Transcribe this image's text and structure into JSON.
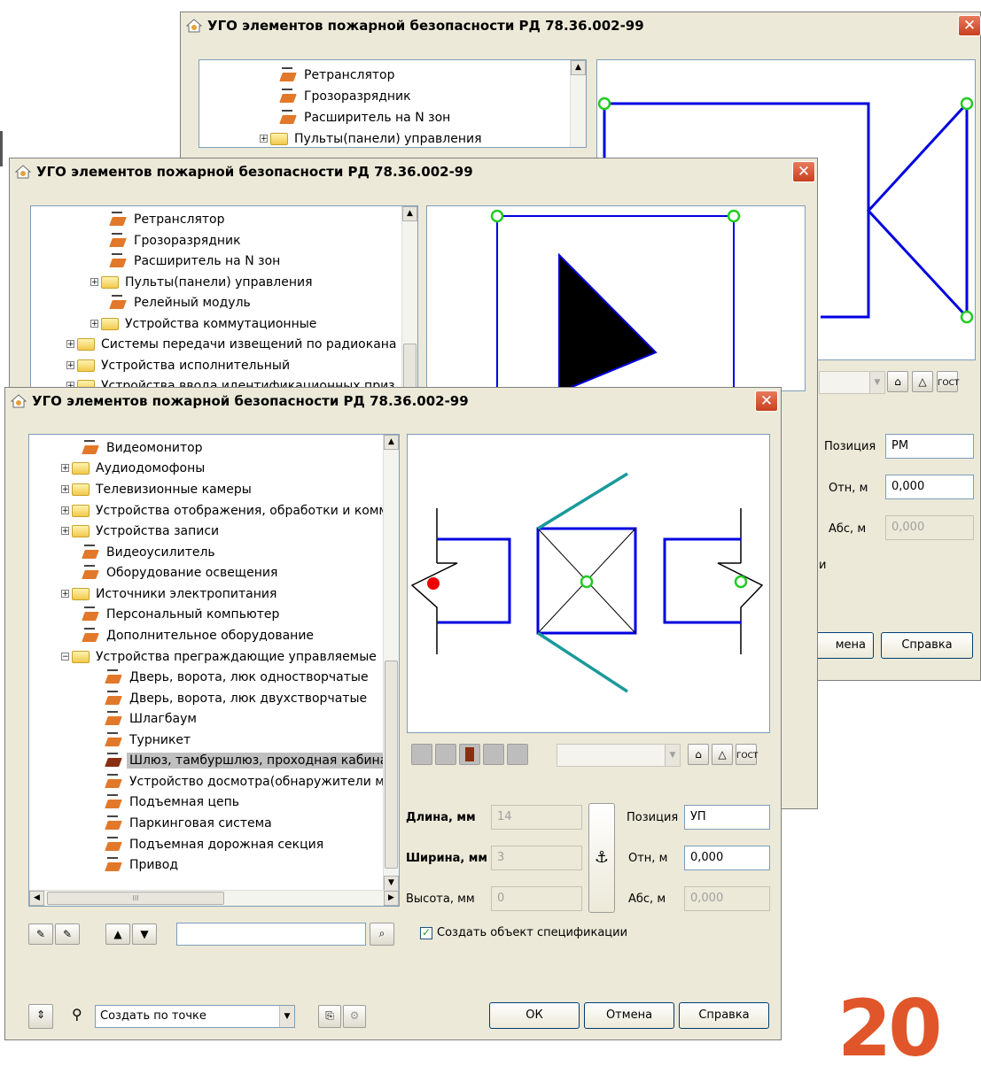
{
  "dialog_title": "УГО элементов пожарной безопасности РД 78.36.002-99",
  "close_glyph": "✕",
  "back_window": {
    "tree": [
      "Ретранслятор",
      "Грозоразрядник",
      "Расширитель на N зон",
      "Пульты(панели) управления"
    ],
    "position_label": "Позиция",
    "position_value": "РМ",
    "rel_label": "Отн, м",
    "rel_value": "0,000",
    "abs_label": "Абс, м",
    "abs_value": "0,000",
    "partial_label": "и",
    "cancel_partial": "мена",
    "help_button": "Справка"
  },
  "middle_window": {
    "tree": [
      "Ретранслятор",
      "Грозоразрядник",
      "Расширитель на N зон",
      "Пульты(панели) управления",
      "Релейный модуль",
      "Устройства коммутационные",
      "Системы передачи извещений по радиокана",
      "Устройства исполнительный",
      "Устройства ввода идентификационных приз"
    ]
  },
  "front_window": {
    "tree": [
      {
        "label": "Видеомонитор",
        "icon": "brick"
      },
      {
        "label": "Аудиодомофоны",
        "icon": "folder"
      },
      {
        "label": "Телевизионные камеры",
        "icon": "folder"
      },
      {
        "label": "Устройства отображения, обработки и комм",
        "icon": "folder"
      },
      {
        "label": "Устройства записи",
        "icon": "folder"
      },
      {
        "label": "Видеоусилитель",
        "icon": "brick"
      },
      {
        "label": "Оборудование освещения",
        "icon": "brick"
      },
      {
        "label": "Источники электропитания",
        "icon": "folder"
      },
      {
        "label": "Персональный компьютер",
        "icon": "brick"
      },
      {
        "label": "Дополнительное оборудование",
        "icon": "brick"
      },
      {
        "label": "Устройства преграждающие управляемые",
        "icon": "folder"
      },
      {
        "label": "Дверь, ворота, люк одностворчатые",
        "icon": "brick"
      },
      {
        "label": "Дверь, ворота, люк двухстворчатые",
        "icon": "brick"
      },
      {
        "label": "Шлагбаум",
        "icon": "brick"
      },
      {
        "label": "Турникет",
        "icon": "brick"
      },
      {
        "label": "Шлюз, тамбуршлюз, проходная кабина",
        "icon": "brick",
        "selected": true
      },
      {
        "label": "Устройство досмотра(обнаружители мет",
        "icon": "brick"
      },
      {
        "label": "Подъемная цепь",
        "icon": "brick"
      },
      {
        "label": "Паркинговая система",
        "icon": "brick"
      },
      {
        "label": "Подъемная дорожная секция",
        "icon": "brick"
      },
      {
        "label": "Привод",
        "icon": "brick"
      }
    ],
    "length_label": "Длина, мм",
    "length_value": "14",
    "width_label": "Ширина, мм",
    "width_value": "3",
    "height_label": "Высота, мм",
    "height_value": "0",
    "position_label": "Позиция",
    "position_value": "УП",
    "rel_label": "Отн, м",
    "rel_value": "0,000",
    "abs_label": "Абс, м",
    "abs_value": "0,000",
    "create_spec_label": "Создать объект спецификации",
    "create_spec_checked": true,
    "mode_value": "Создать по точке",
    "gost_label": "ГОСТ",
    "ok_button": "ОК",
    "cancel_button": "Отмена",
    "help_button": "Справка",
    "search_value": "",
    "scroll_h_mark": "III",
    "anchor_glyph": "⚓"
  },
  "slide_number": "20",
  "colors": {
    "accent": "#0000e0",
    "teal": "#1a9a9a",
    "point": "#22cc22",
    "red": "#ee0000",
    "slide_number": "#e0562a"
  }
}
